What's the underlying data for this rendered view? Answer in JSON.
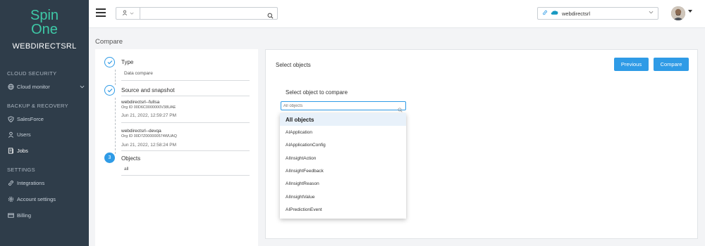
{
  "sidebar": {
    "logo_line1": "Spin",
    "logo_line2": "One",
    "org_name": "WEBDIRECTSRL",
    "sections": {
      "cloud_security": "CLOUD SECURITY",
      "backup_recovery": "BACKUP & RECOVERY",
      "settings": "SETTINGS"
    },
    "items": [
      {
        "label": "Cloud monitor",
        "icon": "globe-icon"
      },
      {
        "label": "SalesForce",
        "icon": "shield-icon"
      },
      {
        "label": "Users",
        "icon": "user-icon"
      },
      {
        "label": "Jobs",
        "icon": "jobs-icon"
      },
      {
        "label": "Integrations",
        "icon": "link-icon"
      },
      {
        "label": "Account settings",
        "icon": "gear-icon"
      },
      {
        "label": "Billing",
        "icon": "card-icon"
      }
    ]
  },
  "topbar": {
    "search_placeholder": "",
    "org_selector_value": "webdirectsrl"
  },
  "page": {
    "title": "Compare"
  },
  "steps": {
    "type": {
      "title": "Type",
      "value": "Data compare"
    },
    "source": {
      "title": "Source and snapshot",
      "snapshots": [
        {
          "name": "webdirectsrl--fullsa",
          "org_id": "Org ID 00D6C0000000V38UAE",
          "date": "Jun 21, 2022, 12:59:27 PM"
        },
        {
          "name": "webdirectsrl--devqa",
          "org_id": "Org ID 00D7Z000000574WUAQ",
          "date": "Jun 21, 2022, 12:58:24 PM"
        }
      ]
    },
    "objects": {
      "number": "3",
      "title": "Objects",
      "value": "all"
    }
  },
  "main": {
    "title": "Select objects",
    "previous_label": "Previous",
    "compare_label": "Compare",
    "select_label": "Select object to compare",
    "input_placeholder": "All objects",
    "options": [
      "All objects",
      "AIApplication",
      "AIApplicationConfig",
      "AIInsightAction",
      "AIInsightFeedback",
      "AIInsightReason",
      "AIInsightValue",
      "AIPredictionEvent"
    ]
  },
  "colors": {
    "sidebar_bg": "#2f3d4a",
    "logo": "#3ec9a7",
    "accent": "#2f9be6"
  }
}
